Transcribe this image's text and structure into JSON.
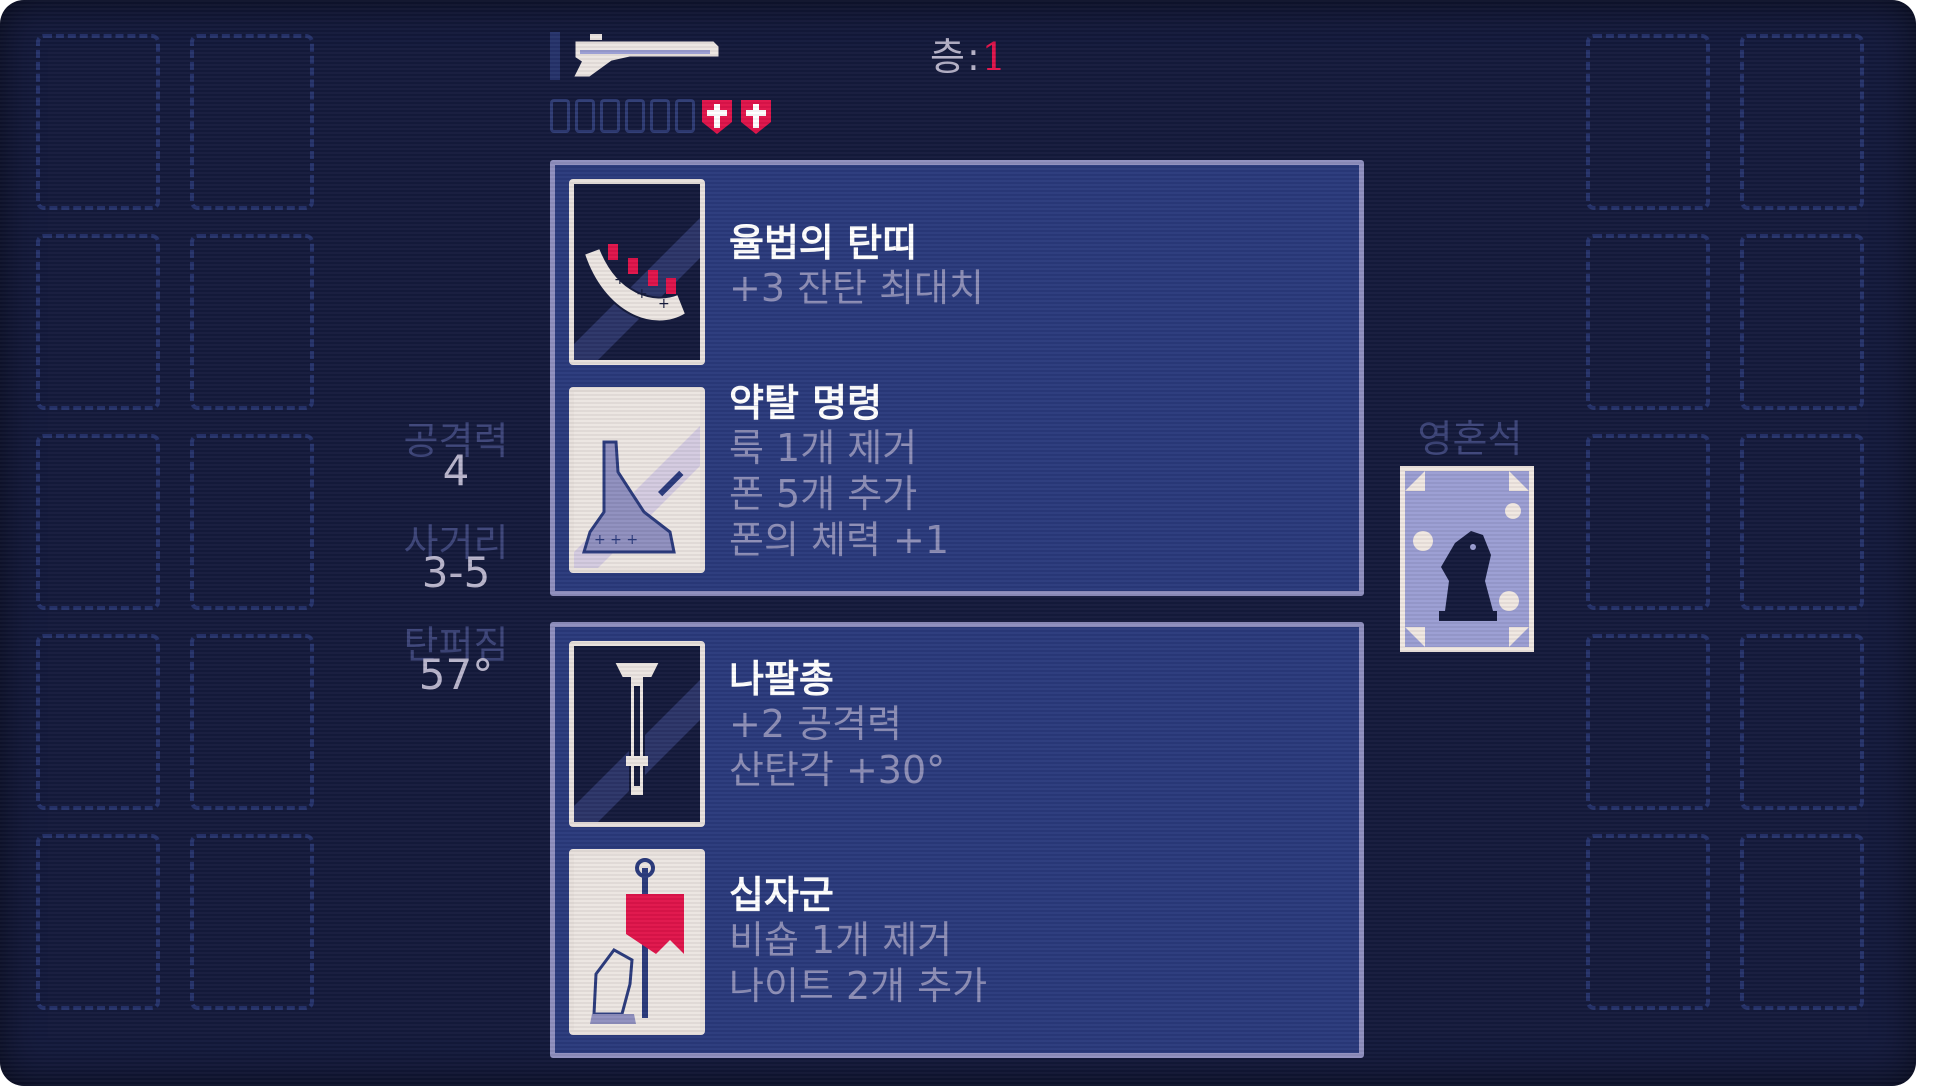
{
  "hud": {
    "floor_label": "층:",
    "floor_value": "1",
    "ammo_slots": 6,
    "hearts": 2,
    "weapon_icon": "shotgun-icon"
  },
  "stats": {
    "attack_label": "공격력",
    "attack_value": "4",
    "range_label": "사거리",
    "range_value": "3-5",
    "spread_label": "탄퍼짐",
    "spread_value": "57°"
  },
  "offer_1": {
    "item_a": {
      "icon": "ammo-belt-icon",
      "name": "율법의 탄띠",
      "lines": [
        "+3 잔탄 최대치"
      ]
    },
    "item_b": {
      "icon": "rook-command-icon",
      "name": "약탈 명령",
      "lines": [
        "룩 1개 제거",
        "폰 5개 추가",
        "폰의 체력 +1"
      ]
    }
  },
  "offer_2": {
    "item_a": {
      "icon": "napalm-gun-icon",
      "name": "나팔총",
      "lines": [
        "+2 공격력",
        "산탄각 +30°"
      ]
    },
    "item_b": {
      "icon": "crusader-banner-icon",
      "name": "십자군",
      "lines": [
        "비숍 1개 제거",
        "나이트 2개 추가"
      ]
    }
  },
  "soul_stone": {
    "label": "영혼석",
    "icon": "knight-piece-icon"
  },
  "colors": {
    "background": "#141a3c",
    "panel": "#2a3a7c",
    "accent_red": "#e0144b",
    "slot_outline": "#26336b"
  }
}
